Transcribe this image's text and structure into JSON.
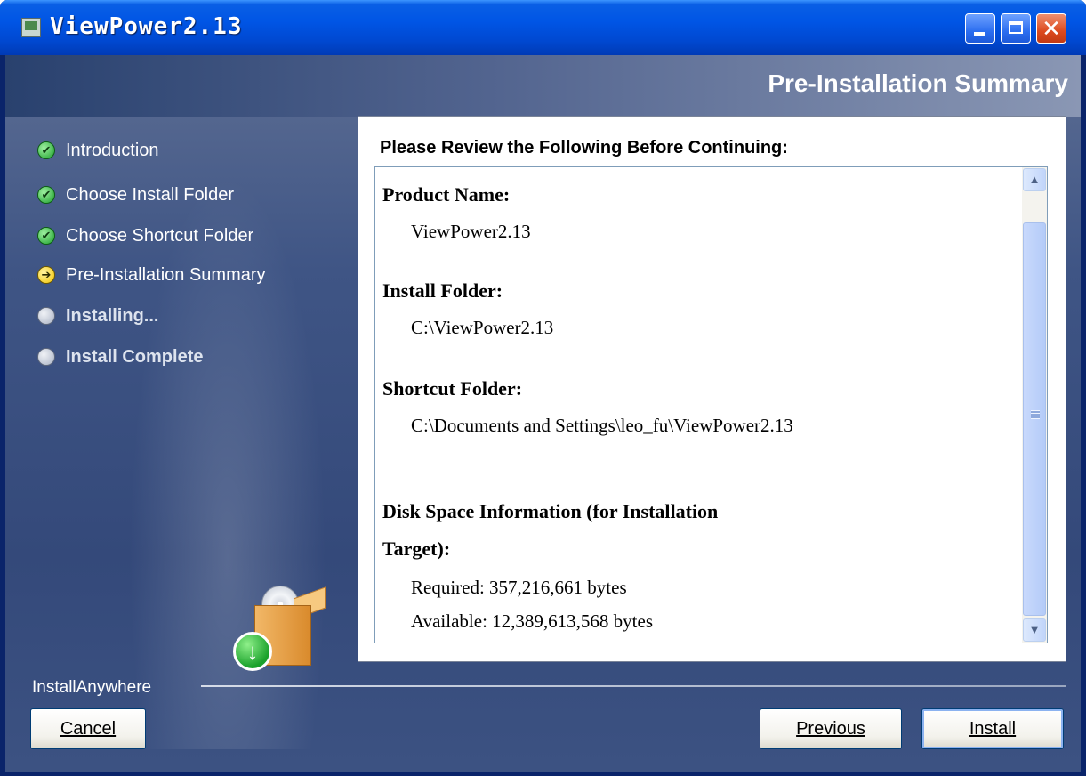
{
  "window": {
    "title": "ViewPower2.13"
  },
  "header": {
    "title": "Pre-Installation Summary"
  },
  "steps": [
    {
      "label": "Introduction",
      "state": "done"
    },
    {
      "label": "Choose Install Folder",
      "state": "done"
    },
    {
      "label": "Choose Shortcut Folder",
      "state": "done"
    },
    {
      "label": "Pre-Installation Summary",
      "state": "current"
    },
    {
      "label": "Installing...",
      "state": "pending"
    },
    {
      "label": "Install Complete",
      "state": "pending"
    }
  ],
  "panel": {
    "heading": "Please Review the Following Before Continuing:",
    "product_name_label": "Product Name:",
    "product_name_value": "ViewPower2.13",
    "install_folder_label": "Install Folder:",
    "install_folder_value": "C:\\ViewPower2.13",
    "shortcut_folder_label": "Shortcut Folder:",
    "shortcut_folder_value": "C:\\Documents and Settings\\leo_fu\\ViewPower2.13",
    "disk_space_label_line1": "Disk Space Information (for Installation",
    "disk_space_label_line2": "Target):",
    "required_value": "Required: 357,216,661 bytes",
    "available_value": "Available: 12,389,613,568 bytes"
  },
  "footer": {
    "brand": "InstallAnywhere",
    "cancel_label": "Cancel",
    "previous_label": "Previous",
    "install_label": "Install"
  },
  "colors": {
    "titlebar": "#0055e5",
    "sidebar": "#3f5585",
    "accent_check": "#1a9e2a",
    "current_step": "#f2c400"
  }
}
